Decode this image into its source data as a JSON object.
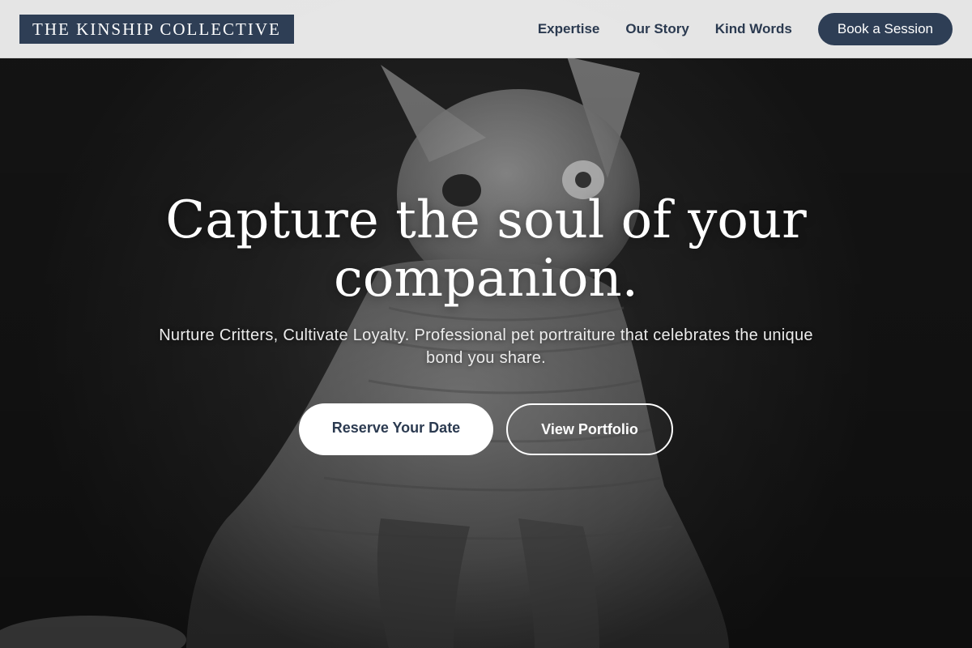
{
  "brand": {
    "name": "THE KINSHIP COLLECTIVE"
  },
  "nav": {
    "links": [
      "Expertise",
      "Our Story",
      "Kind Words"
    ],
    "cta_label": "Book a Session"
  },
  "hero": {
    "title": "Capture the soul of your companion.",
    "subtitle": "Nurture Critters, Cultivate Loyalty. Professional pet portraiture that celebrates the unique bond you share.",
    "primary_button": "Reserve Your Date",
    "secondary_button": "View Portfolio"
  },
  "colors": {
    "brand_navy": "#2e3e55",
    "header_bg": "#eeeeee",
    "text_on_dark": "#ffffff"
  }
}
